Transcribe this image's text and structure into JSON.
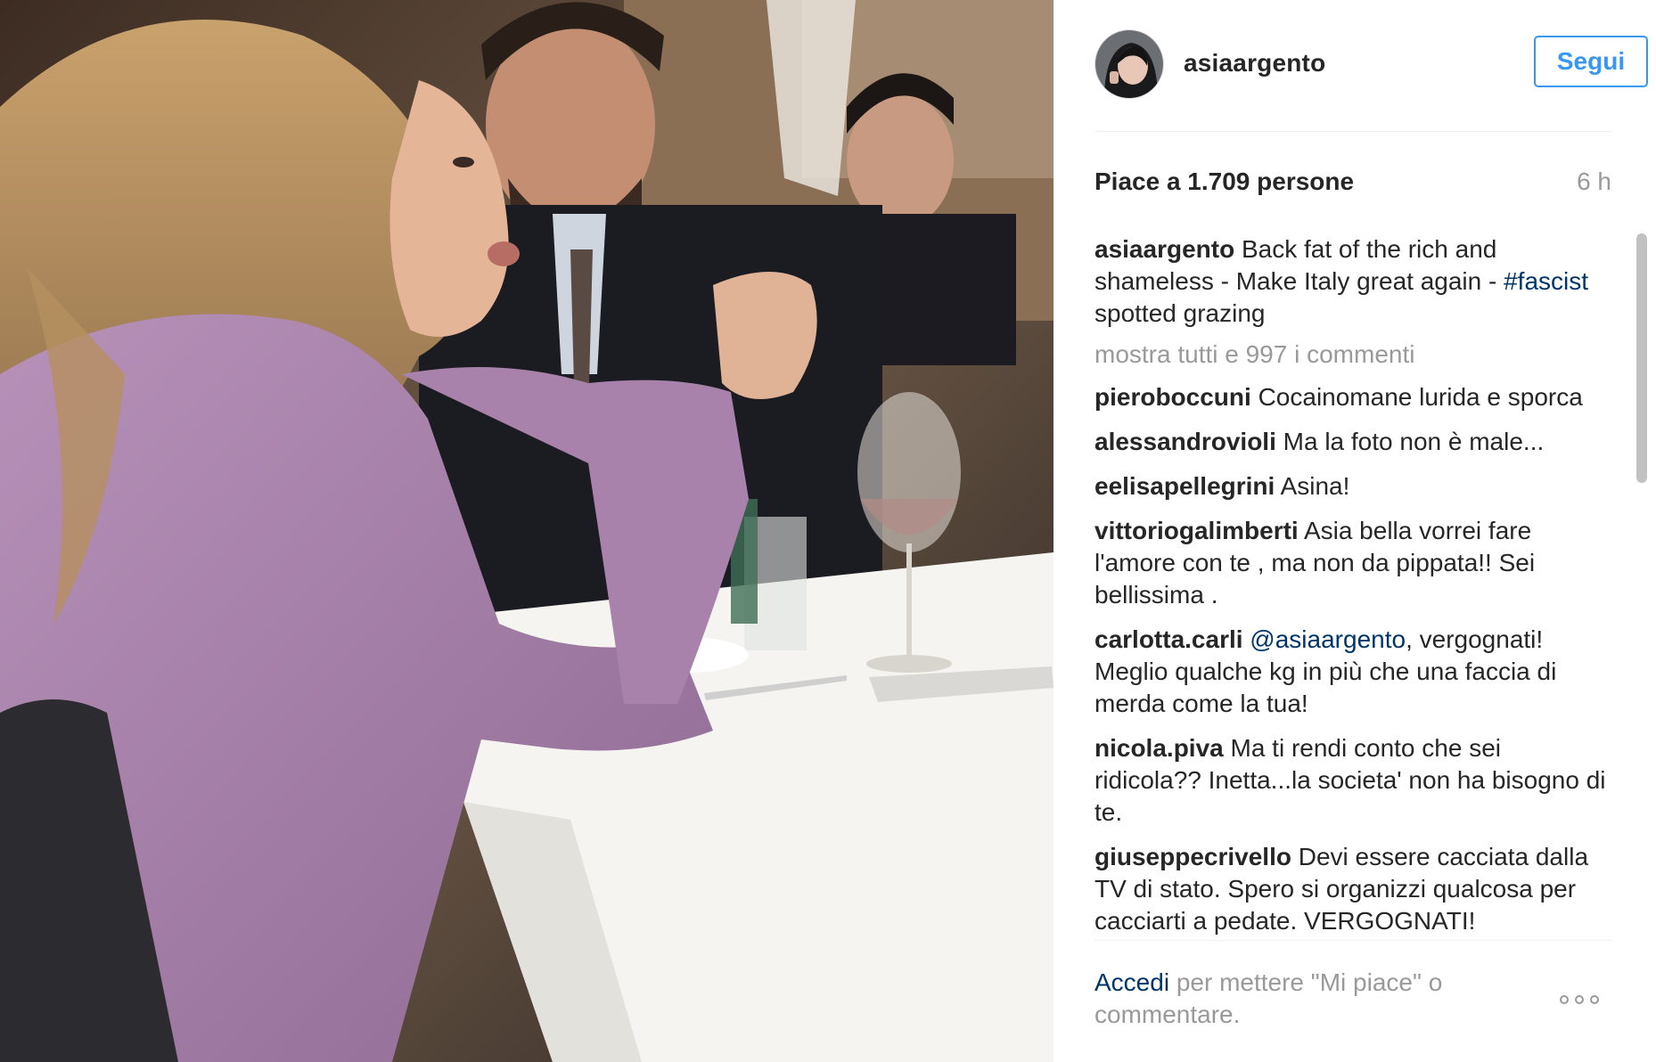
{
  "post": {
    "photo_description_icon": "photo-icon"
  },
  "header": {
    "username": "asiaargento",
    "follow_label": "Segui"
  },
  "stats": {
    "likes": "Piace a 1.709 persone",
    "time": "6 h"
  },
  "caption": {
    "user": "asiaargento",
    "text_1": " Back fat of the rich and shameless - Make Italy great again - ",
    "hashtag": "#fascist",
    "text_2": " spotted grazing"
  },
  "view_all": "mostra tutti e 997 i commenti",
  "comments": [
    {
      "user": "pieroboccuni",
      "text": " Cocainomane lurida e sporca"
    },
    {
      "user": "alessandrovioli",
      "text": " Ma la foto non è male..."
    },
    {
      "user": "eelisapellegrini",
      "text": " Asina!"
    },
    {
      "user": "vittoriogalimberti",
      "text": " Asia bella vorrei fare l'amore con te , ma non da pippata!! Sei bellissima ."
    },
    {
      "user": "carlotta.carli",
      "mention": " @asiaargento",
      "text": ", vergognati! Meglio qualche kg in più che una faccia di merda come la tua!"
    },
    {
      "user": "nicola.piva",
      "text": " Ma ti rendi conto che sei ridicola?? Inetta...la societa' non ha bisogno di te."
    },
    {
      "user": "giuseppecrivello",
      "text": " Devi essere cacciata dalla TV di stato. Spero si organizzi qualcosa per cacciarti a pedate. VERGOGNATI!"
    }
  ],
  "footer": {
    "login_label": "Accedi",
    "rest": " per mettere \"Mi piace\" o commentare."
  },
  "colors": {
    "accent": "#3897f0",
    "link": "#003569",
    "muted": "#999999"
  }
}
